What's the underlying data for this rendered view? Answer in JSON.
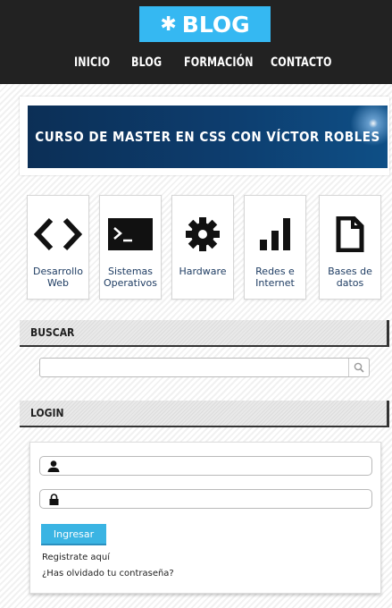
{
  "header": {
    "logo_text": "BLOG",
    "logo_icon": "gear-icon",
    "nav": [
      "INICIO",
      "BLOG",
      "FORMACIÓN",
      "CONTACTO"
    ]
  },
  "banner": {
    "text": "CURSO DE MASTER EN CSS CON VÍCTOR ROBLES"
  },
  "categories": [
    {
      "icon": "code-icon",
      "label": "Desarrollo Web"
    },
    {
      "icon": "terminal-icon",
      "label": "Sistemas Operativos"
    },
    {
      "icon": "gear-icon",
      "label": "Hardware"
    },
    {
      "icon": "signal-bars-icon",
      "label": "Redes e Internet"
    },
    {
      "icon": "file-icon",
      "label": "Bases de datos"
    }
  ],
  "search": {
    "title": "BUSCAR",
    "value": "",
    "placeholder": ""
  },
  "login": {
    "title": "LOGIN",
    "user_value": "",
    "password_value": "",
    "submit_label": "Ingresar",
    "register_link": "Registrate aquí",
    "forgot_link": "¿Has olvidado tu contraseña?"
  },
  "colors": {
    "accent": "#35b8f2",
    "header_bg": "#222222",
    "button": "#3ab4e3",
    "banner": "#0d3d6e"
  }
}
